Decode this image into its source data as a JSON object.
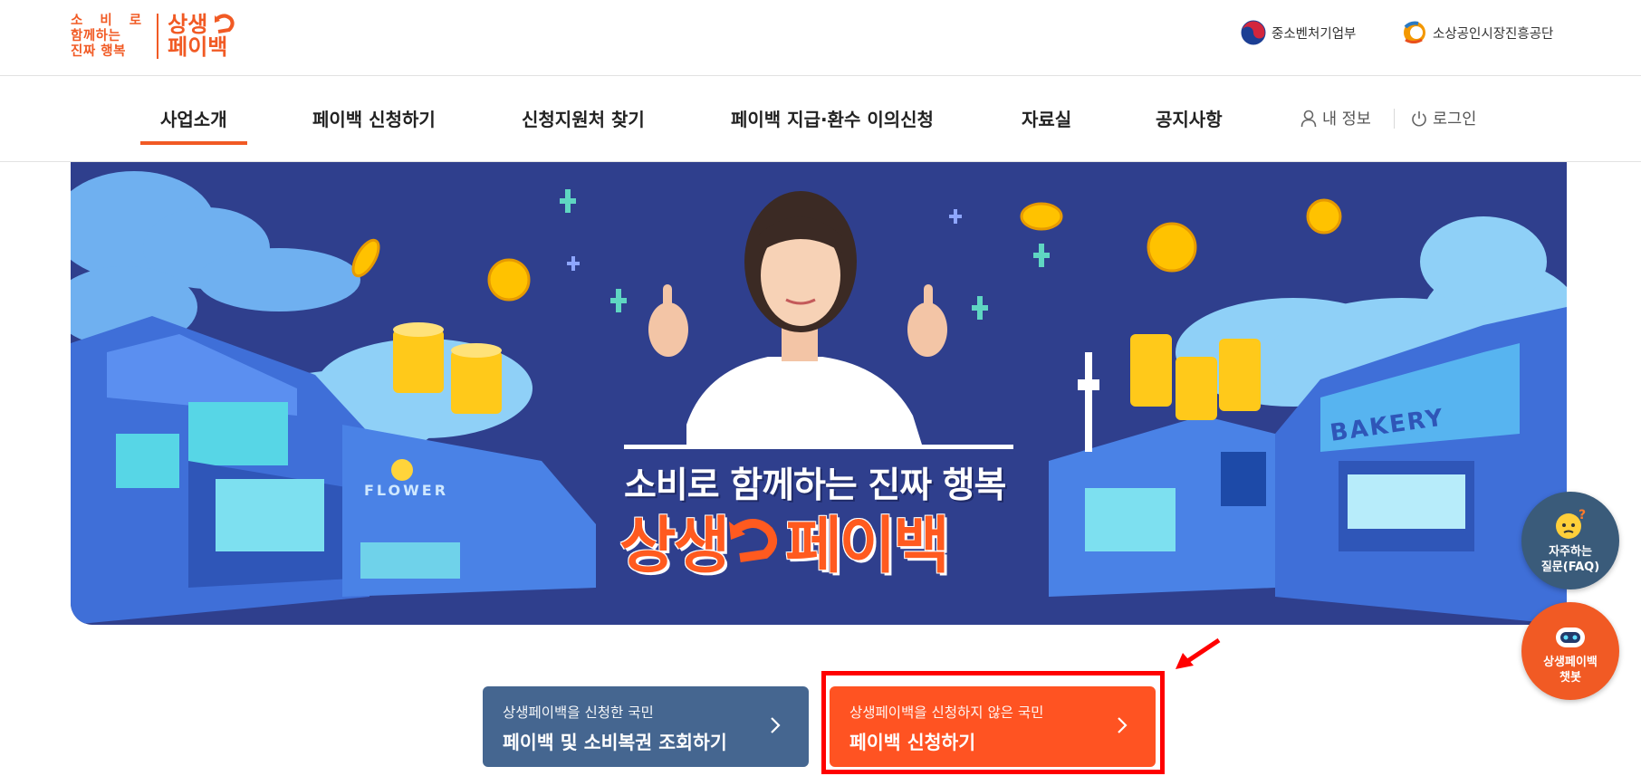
{
  "header": {
    "logo": {
      "tagline_line1": "소 비 로",
      "tagline_line2": "함께하는",
      "tagline_line3": "진짜 행복",
      "brand_line1": "상생",
      "brand_line2": "페이백"
    },
    "agencies": [
      {
        "label": "중소벤처기업부",
        "icon": "korea-emblem-icon"
      },
      {
        "label": "소상공인시장진흥공단",
        "icon": "semas-logo-icon"
      }
    ]
  },
  "nav": {
    "items": [
      {
        "label": "사업소개",
        "active": true
      },
      {
        "label": "페이백 신청하기"
      },
      {
        "label": "신청지원처 찾기"
      },
      {
        "label": "페이백 지급·환수 이의신청"
      },
      {
        "label": "자료실"
      },
      {
        "label": "공지사항"
      }
    ],
    "my_info": "내 정보",
    "login": "로그인"
  },
  "hero": {
    "slogan": "소비로 함께하는 진짜 행복",
    "brand_left": "상생",
    "brand_right": "페이백",
    "store_signs": [
      "FLOWER",
      "BAKERY"
    ]
  },
  "floating": {
    "faq_label_line1": "자주하는",
    "faq_label_line2": "질문(FAQ)",
    "chatbot_label_line1": "상생페이백",
    "chatbot_label_line2": "챗봇"
  },
  "cta": {
    "lookup": {
      "sub": "상생페이백을 신청한 국민",
      "main": "페이백 및 소비복권 조회하기"
    },
    "apply": {
      "sub": "상생페이백을 신청하지 않은 국민",
      "main": "페이백 신청하기"
    }
  },
  "colors": {
    "accent": "#f15a24",
    "hero_bg": "#2f3f8d",
    "lookup_btn": "#456690",
    "apply_btn": "#ff5322",
    "highlight": "#ff0000"
  }
}
